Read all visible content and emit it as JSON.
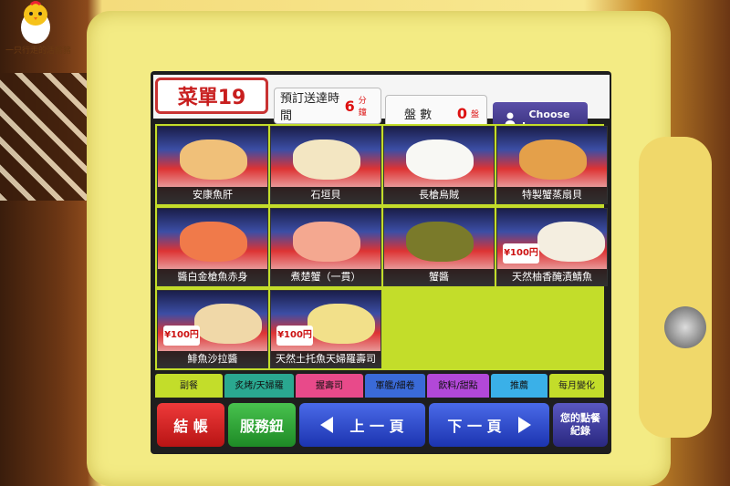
{
  "watermark": {
    "text": "一只行走的活豬豬"
  },
  "header": {
    "menu_title": "菜單19",
    "eta_label": "預訂送達時間",
    "eta_value": "6",
    "eta_unit": "分鐘",
    "plates_label": "盤 數",
    "plates_value": "0",
    "plates_unit": "盤",
    "language_button": "Choose Language"
  },
  "menu_items": [
    {
      "name": "安康魚肝",
      "price": ""
    },
    {
      "name": "石垣貝",
      "price": ""
    },
    {
      "name": "長槍烏賊",
      "price": ""
    },
    {
      "name": "特製蟹蒸扇貝",
      "price": ""
    },
    {
      "name": "醬白金槍魚赤身",
      "price": ""
    },
    {
      "name": "煮楚蟹（一貫）",
      "price": ""
    },
    {
      "name": "蟹醬",
      "price": ""
    },
    {
      "name": "天然柚香醃漬鯖魚",
      "price": "¥100円"
    },
    {
      "name": "鯡魚沙拉醬",
      "price": "¥100円"
    },
    {
      "name": "天然土托魚天婦羅壽司",
      "price": "¥100円"
    }
  ],
  "tabs": [
    {
      "label": "副餐",
      "color": "#c3dd2a"
    },
    {
      "label": "炙烤/天婦羅",
      "color": "#2aa890"
    },
    {
      "label": "握壽司",
      "color": "#e84a8a"
    },
    {
      "label": "軍艦/細卷",
      "color": "#3a6ad8"
    },
    {
      "label": "飲料/甜點",
      "color": "#b248d8"
    },
    {
      "label": "推薦",
      "color": "#3ab0e8"
    },
    {
      "label": "每月變化",
      "color": "#c3dd2a"
    }
  ],
  "buttons": {
    "checkout": "結 帳",
    "service": "服務鈕",
    "prev": "上 一 頁",
    "next": "下 一 頁",
    "history": "您的點餐紀錄"
  },
  "colors": {
    "grid_bg": "#c3dd2a",
    "checkout": "#d62020",
    "service": "#2ea83a",
    "nav": "#2848c8",
    "history": "#3b3aa0"
  }
}
